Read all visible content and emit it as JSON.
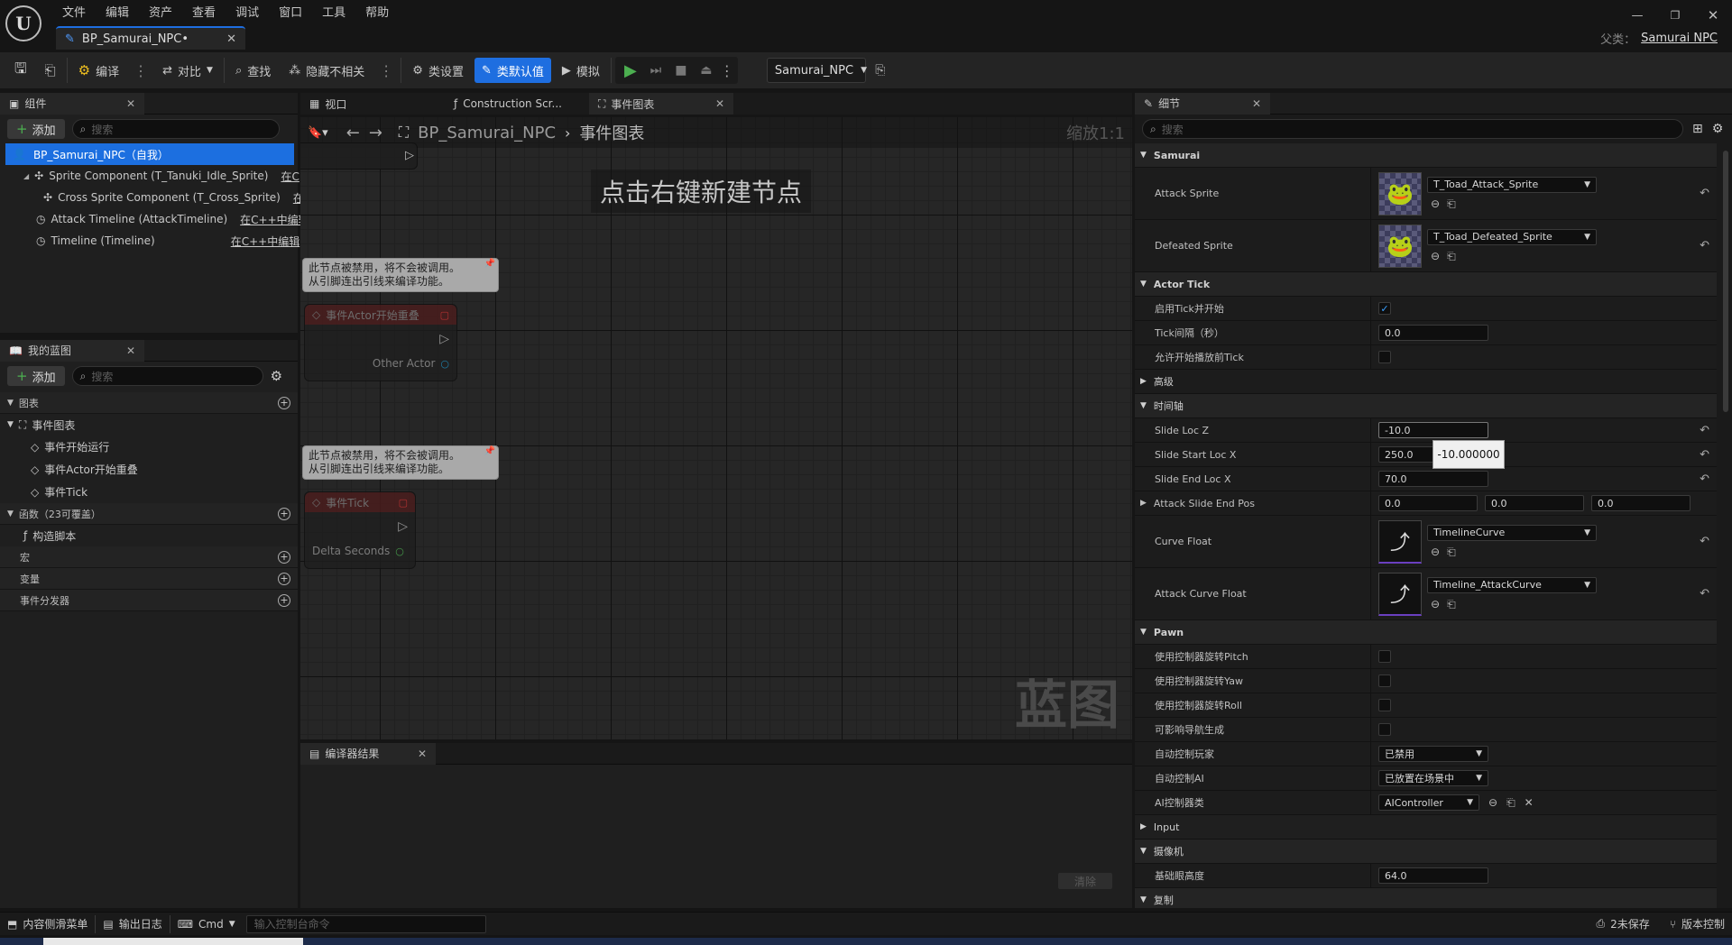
{
  "menu": {
    "items": [
      "文件",
      "编辑",
      "资产",
      "查看",
      "调试",
      "窗口",
      "工具",
      "帮助"
    ]
  },
  "document_tab": {
    "title": "BP_Samurai_NPC•"
  },
  "parent_class": {
    "label": "父类：",
    "value": "Samurai NPC"
  },
  "toolbar": {
    "compile": "编译",
    "diff": "对比",
    "find": "查找",
    "hide_unrelated": "隐藏不相关",
    "class_settings": "类设置",
    "class_defaults": "类默认值",
    "simulate": "模拟",
    "debug_object": "Samurai_NPC"
  },
  "components_panel": {
    "tab": "组件",
    "add": "添加",
    "search_placeholder": "搜索",
    "root": "BP_Samurai_NPC（自我）",
    "items": [
      {
        "label": "Sprite Component (T_Tanuki_Idle_Sprite)",
        "link": "在C"
      },
      {
        "label": "Cross Sprite Component (T_Cross_Sprite)",
        "link": "在"
      },
      {
        "label": "Attack Timeline (AttackTimeline)",
        "link": "在C++中编辑"
      },
      {
        "label": "Timeline (Timeline)",
        "link": "在C++中编辑"
      }
    ]
  },
  "my_blueprint": {
    "tab": "我的蓝图",
    "add": "添加",
    "search_placeholder": "搜索",
    "graphs": "图表",
    "event_graph": "事件图表",
    "events": [
      "事件开始运行",
      "事件Actor开始重叠",
      "事件Tick"
    ],
    "functions": "函数（23可覆盖）",
    "construction_script": "构造脚本",
    "macros": "宏",
    "variables": "变量",
    "dispatchers": "事件分发器"
  },
  "graph_tabs": {
    "viewport": "视口",
    "construction": "Construction Scr...",
    "event_graph": "事件图表"
  },
  "graph": {
    "breadcrumb_root": "BP_Samurai_NPC",
    "breadcrumb_current": "事件图表",
    "zoom": "缩放1:1",
    "hint": "点击右键新建节点",
    "watermark": "蓝图",
    "disabled_comment_1": "此节点被禁用，将不会被调用。",
    "disabled_comment_2": "从引脚连出引线来编译功能。",
    "node_overlap_title": "事件Actor开始重叠",
    "node_overlap_pin": "Other Actor",
    "node_tick_title": "事件Tick",
    "node_tick_pin": "Delta Seconds"
  },
  "compiler": {
    "tab": "编译器结果",
    "clear": "清除"
  },
  "details": {
    "tab": "细节",
    "search_placeholder": "搜索",
    "sections": {
      "samurai": "Samurai",
      "actor_tick": "Actor Tick",
      "advanced": "高级",
      "timeline": "时间轴",
      "pawn": "Pawn",
      "input": "Input",
      "camera": "摄像机",
      "replication": "复制"
    },
    "attack_sprite": {
      "label": "Attack Sprite",
      "value": "T_Toad_Attack_Sprite"
    },
    "defeated_sprite": {
      "label": "Defeated Sprite",
      "value": "T_Toad_Defeated_Sprite"
    },
    "tick_start": {
      "label": "启用Tick并开始",
      "checked": true
    },
    "tick_interval": {
      "label": "Tick间隔（秒）",
      "value": "0.0"
    },
    "tick_before_play": {
      "label": "允许开始播放前Tick",
      "checked": false
    },
    "slide_loc_z": {
      "label": "Slide Loc Z",
      "value": "-10.0",
      "tooltip": "-10.000000"
    },
    "slide_start_loc_x": {
      "label": "Slide Start Loc X",
      "value": "250.0"
    },
    "slide_end_loc_x": {
      "label": "Slide End Loc X",
      "value": "70.0"
    },
    "attack_slide_end_pos": {
      "label": "Attack Slide End Pos",
      "x": "0.0",
      "y": "0.0",
      "z": "0.0"
    },
    "curve_float": {
      "label": "Curve Float",
      "value": "TimelineCurve"
    },
    "attack_curve_float": {
      "label": "Attack Curve Float",
      "value": "Timeline_AttackCurve"
    },
    "pitch": {
      "label": "使用控制器旋转Pitch",
      "checked": false
    },
    "yaw": {
      "label": "使用控制器旋转Yaw",
      "checked": false
    },
    "roll": {
      "label": "使用控制器旋转Roll",
      "checked": false
    },
    "nav": {
      "label": "可影响导航生成",
      "checked": false
    },
    "auto_possess_player": {
      "label": "自动控制玩家",
      "value": "已禁用"
    },
    "auto_possess_ai": {
      "label": "自动控制AI",
      "value": "已放置在场景中"
    },
    "ai_controller_class": {
      "label": "AI控制器类",
      "value": "AIController"
    },
    "base_eye_height": {
      "label": "基础眼高度",
      "value": "64.0"
    }
  },
  "statusbar": {
    "content_drawer": "内容侧滑菜单",
    "output_log": "输出日志",
    "cmd": "Cmd",
    "console_placeholder": "输入控制台命令",
    "unsaved": "2未保存",
    "source_control": "版本控制"
  },
  "colors": {
    "accent_blue": "#1e6ee0",
    "play_green": "#4caf50",
    "selected_row": "#1c6fe0"
  }
}
